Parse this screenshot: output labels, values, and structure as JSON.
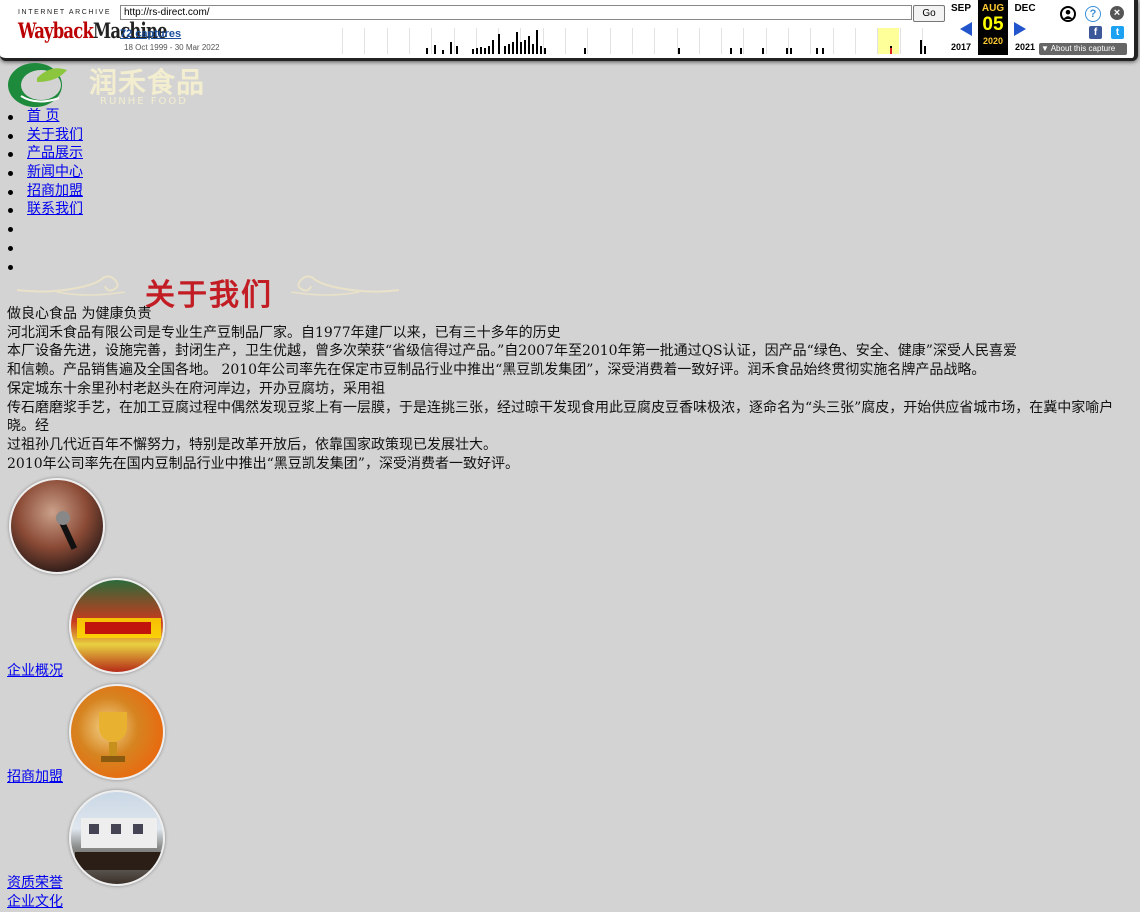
{
  "wayback": {
    "ia_label": "INTERNET ARCHIVE",
    "logo_text_a": "Wayback",
    "logo_text_b": "Machine",
    "url": "http://rs-direct.com/",
    "go_label": "Go",
    "captures": "72 captures",
    "date_range": "18 Oct 1999 - 30 Mar 2022",
    "prev_month": "SEP",
    "cur_month": "AUG",
    "next_month": "DEC",
    "cur_day": "05",
    "prev_year": "2017",
    "cur_year": "2020",
    "next_year": "2021",
    "about_label": "About this capture",
    "icons": [
      "user-icon",
      "help-icon",
      "close-icon",
      "facebook-icon",
      "twitter-icon"
    ]
  },
  "site": {
    "brand": "润禾食品",
    "brand_en": "RUNHE FOOD"
  },
  "nav": [
    "首 页",
    "关于我们",
    "产品展示",
    "新闻中心",
    "招商加盟",
    "联系我们"
  ],
  "about": {
    "title": "关于我们",
    "lines": [
      "做良心食品 为健康负责",
      "河北润禾食品有限公司是专业生产豆制品厂家。自1977年建厂以来，已有三十多年的历史",
      "本厂设备先进，设施完善，封闭生产，卫生优越，曾多次荣获“省级信得过产品。”自2007年至2010年第一批通过QS认证，因产品“绿色、安全、健康”深受人民喜爱",
      "和信赖。产品销售遍及全国各地。 2010年公司率先在保定市豆制品行业中推出“黑豆凯发集团”，深受消费着一致好评。润禾食品始终贯彻实施名牌产品战略。",
      "保定城东十余里孙村老赵头在府河岸边，开办豆腐坊，采用祖",
      "传石磨磨浆手艺，在加工豆腐过程中偶然发现豆浆上有一层膜，于是连挑三张，经过晾干发现食用此豆腐皮豆香味极浓，逐命名为“头三张”腐皮，开始供应省城市场，在冀中家喻户晓。经",
      "过祖孙几代近百年不懈努力，特别是改革开放后，依靠国家政策现已发展壮大。",
      "2010年公司率先在国内豆制品行业中推出“黑豆凯发集团”，深受消费者一致好评。"
    ]
  },
  "links": [
    "企业概况",
    "招商加盟",
    "资质荣誉",
    "企业文化"
  ],
  "colors": {
    "background": "#d3d3d3",
    "link": "#0000ee",
    "title_red": "#c21d24",
    "logo_green": "#1e8a3c"
  }
}
